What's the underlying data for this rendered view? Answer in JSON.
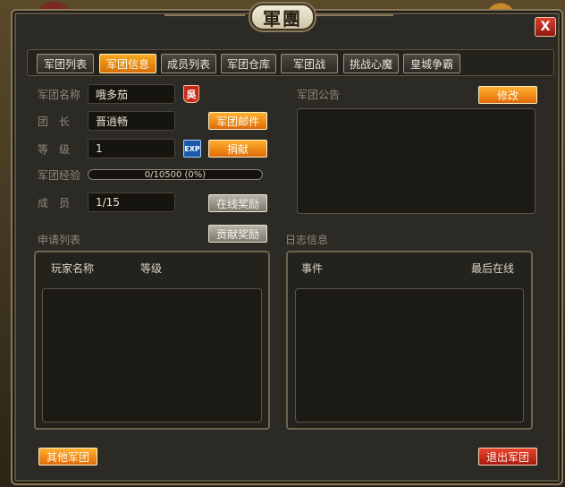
{
  "window": {
    "title": "軍團",
    "close_label": "X"
  },
  "tabs": [
    {
      "label": "军团列表",
      "active": false
    },
    {
      "label": "军团信息",
      "active": true
    },
    {
      "label": "成员列表",
      "active": false
    },
    {
      "label": "军团仓库",
      "active": false
    },
    {
      "label": "军团战",
      "active": false
    },
    {
      "label": "挑战心魔",
      "active": false
    },
    {
      "label": "皇城争霸",
      "active": false
    }
  ],
  "info": {
    "name_label": "军团名称",
    "name_value": "哦多茄",
    "name_badge": "吳",
    "leader_label": "团　长",
    "leader_value": "晋逍畅",
    "mail_button": "军团邮件",
    "level_label": "等　级",
    "level_value": "1",
    "exp_badge": "EXP",
    "donate_button": "捐献",
    "exp_label": "军团经验",
    "exp_text": "0/10500 (0%)",
    "exp_fraction": 0,
    "members_label": "成　员",
    "members_value": "1/15",
    "online_reward_button": "在线奖励",
    "contrib_reward_button": "贡献奖励"
  },
  "notice": {
    "label": "军团公告",
    "edit_button": "修改"
  },
  "applications": {
    "label": "申请列表",
    "col_player": "玩家名称",
    "col_level": "等级"
  },
  "log": {
    "label": "日志信息",
    "col_event": "事件",
    "col_last_online": "最后在线"
  },
  "footer": {
    "other_button": "其他军团",
    "quit_button": "退出军团"
  },
  "colors": {
    "accent_orange": "#e06a08",
    "danger_red": "#a81a0e",
    "gold_fill": "#d88a18"
  }
}
